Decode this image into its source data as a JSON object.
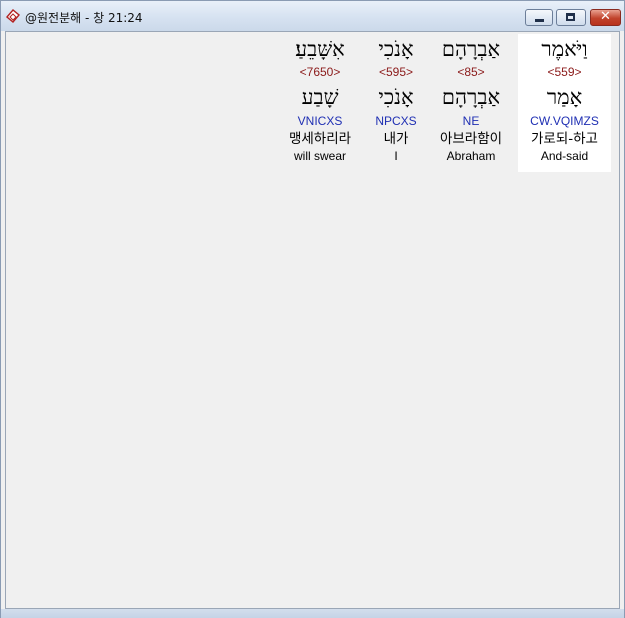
{
  "window": {
    "title": "@원전분해 - 창 21:24",
    "close_label": "✕"
  },
  "words": [
    {
      "hebrew": "וַיֹּאמֶר",
      "strong": "<559>",
      "root": "אָמַר",
      "morph": "CW.VQIMZS",
      "korean": "가로되-하고",
      "english": "And-said",
      "selected": true
    },
    {
      "hebrew": "אַבְרָהָם",
      "strong": "<85>",
      "root": "אַבְרָהָם",
      "morph": "NE",
      "korean": "아브라함이",
      "english": "Abraham",
      "selected": false
    },
    {
      "hebrew": "אָנֹכִי",
      "strong": "<595>",
      "root": "אָנֹכִי",
      "morph": "NPCXS",
      "korean": "내가",
      "english": "I",
      "selected": false
    },
    {
      "hebrew": "אִשָּׁבֵעַ׃",
      "strong": "<7650>",
      "root": "שָׁבַע",
      "morph": "VNICXS",
      "korean": "맹세하리라",
      "english": "will swear",
      "selected": false
    }
  ]
}
